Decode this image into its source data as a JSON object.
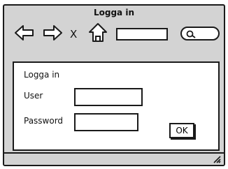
{
  "window": {
    "title": "Logga in"
  },
  "toolbar": {
    "buttons": [
      {
        "icon": "arrow-left-icon"
      },
      {
        "icon": "arrow-right-icon"
      },
      {
        "icon": "close-icon",
        "glyph": "X"
      },
      {
        "icon": "home-icon"
      }
    ],
    "address": {
      "value": ""
    },
    "search": {
      "value": "",
      "icon": "search-icon"
    }
  },
  "form": {
    "heading": "Logga in",
    "user": {
      "label": "User",
      "value": ""
    },
    "password": {
      "label": "Password",
      "value": ""
    },
    "ok_label": "OK"
  },
  "statusbar": {
    "icon": "resize-grip-icon"
  }
}
